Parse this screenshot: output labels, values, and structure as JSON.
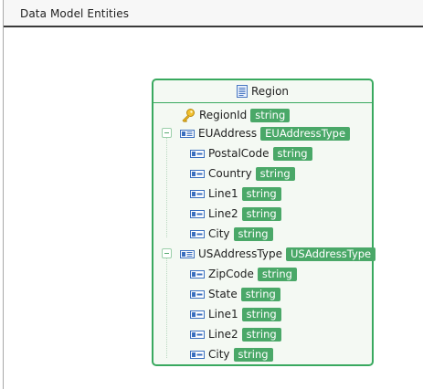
{
  "window": {
    "title": "Data Model Entities"
  },
  "entity": {
    "name": "Region",
    "icon": "document-icon",
    "key": {
      "label": "RegionId",
      "type": "string",
      "icon": "key-icon"
    },
    "groups": [
      {
        "label": "EUAddress",
        "type": "EUAddressType",
        "icon": "complex-field-icon",
        "expanded": true,
        "fields": [
          {
            "label": "PostalCode",
            "type": "string"
          },
          {
            "label": "Country",
            "type": "string"
          },
          {
            "label": "Line1",
            "type": "string"
          },
          {
            "label": "Line2",
            "type": "string"
          },
          {
            "label": "City",
            "type": "string"
          }
        ]
      },
      {
        "label": "USAddressType",
        "type": "USAddressType",
        "icon": "complex-field-icon",
        "expanded": true,
        "fields": [
          {
            "label": "ZipCode",
            "type": "string"
          },
          {
            "label": "State",
            "type": "string"
          },
          {
            "label": "Line1",
            "type": "string"
          },
          {
            "label": "Line2",
            "type": "string"
          },
          {
            "label": "City",
            "type": "string"
          }
        ]
      }
    ]
  },
  "colors": {
    "entity_border": "#39a95f",
    "badge_bg": "#4aa868",
    "entity_bg": "#f4f9f3"
  }
}
